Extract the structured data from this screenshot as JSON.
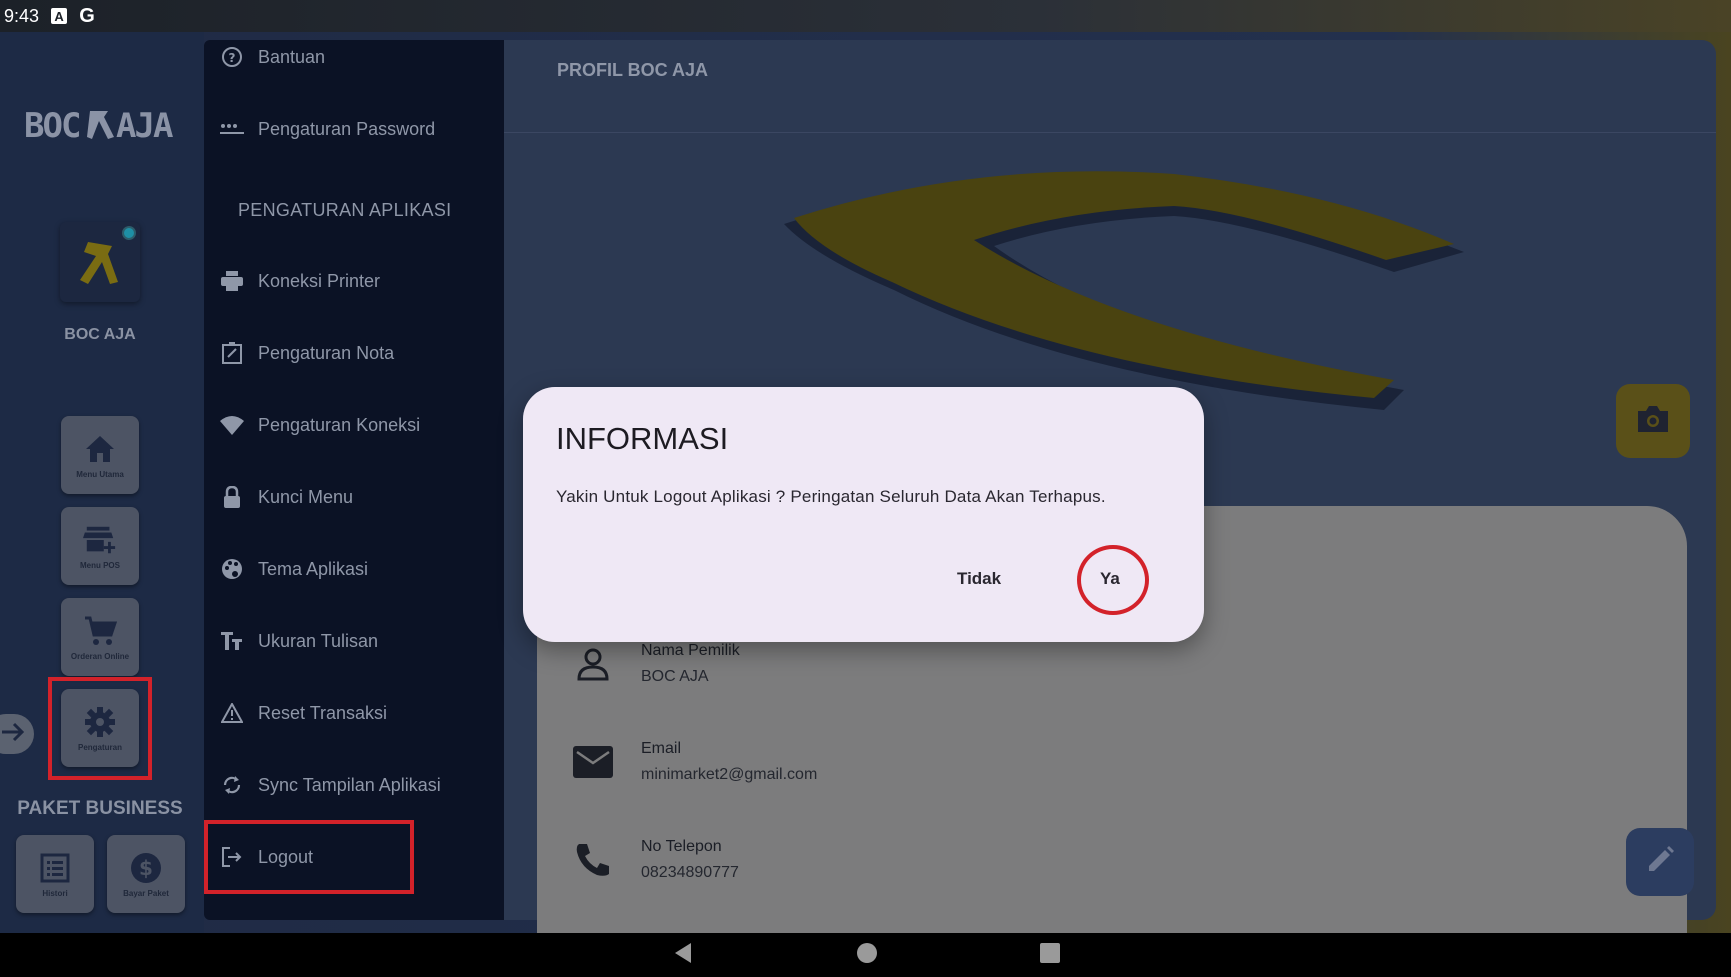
{
  "status_bar": {
    "time": "9:43",
    "icons": [
      "a-notification-icon",
      "google-icon"
    ]
  },
  "rail": {
    "logo_text": "BOC⚒AJA",
    "store_name": "BOC AJA",
    "buttons": [
      {
        "label": "Menu Utama",
        "icon": "home-icon"
      },
      {
        "label": "Menu POS",
        "icon": "store-add-icon"
      },
      {
        "label": "Orderan Online",
        "icon": "cart-icon"
      },
      {
        "label": "Pengaturan",
        "icon": "gear-icon"
      }
    ],
    "paket_label": "PAKET BUSINESS",
    "bottom_buttons": [
      {
        "label": "Histori",
        "icon": "list-icon"
      },
      {
        "label": "Bayar Paket",
        "icon": "dollar-icon"
      }
    ]
  },
  "drawer": {
    "items_top": [
      {
        "label": "Bantuan",
        "icon": "help-icon"
      },
      {
        "label": "Pengaturan Password",
        "icon": "password-icon"
      }
    ],
    "section_title": "PENGATURAN APLIKASI",
    "items": [
      {
        "label": "Koneksi Printer",
        "icon": "printer-icon"
      },
      {
        "label": "Pengaturan Nota",
        "icon": "note-edit-icon"
      },
      {
        "label": "Pengaturan Koneksi",
        "icon": "wifi-icon"
      },
      {
        "label": "Kunci Menu",
        "icon": "lock-icon"
      },
      {
        "label": "Tema Aplikasi",
        "icon": "palette-icon"
      },
      {
        "label": "Ukuran Tulisan",
        "icon": "text-size-icon"
      },
      {
        "label": "Reset Transaksi",
        "icon": "warning-icon"
      },
      {
        "label": "Sync Tampilan Aplikasi",
        "icon": "sync-icon"
      },
      {
        "label": "Logout",
        "icon": "logout-icon"
      }
    ]
  },
  "main": {
    "title": "PROFIL BOC AJA",
    "profile": [
      {
        "label": "Nama Pemilik",
        "value": "BOC AJA",
        "icon": "person-icon"
      },
      {
        "label": "Email",
        "value": "minimarket2@gmail.com",
        "icon": "mail-icon"
      },
      {
        "label": "No Telepon",
        "value": "08234890777",
        "icon": "phone-icon"
      }
    ]
  },
  "dialog": {
    "title": "INFORMASI",
    "message": "Yakin Untuk Logout Aplikasi ? Peringatan Seluruh Data Akan Terhapus.",
    "cancel_label": "Tidak",
    "confirm_label": "Ya"
  },
  "colors": {
    "highlight": "#d3222a",
    "accent_gold": "#e3c21a",
    "dialog_bg": "#efe8f5"
  }
}
